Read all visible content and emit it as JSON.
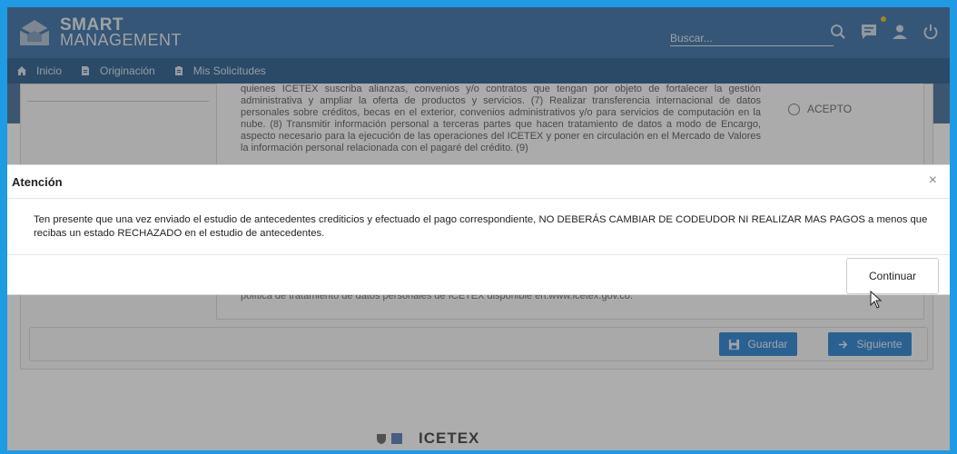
{
  "header": {
    "logo_line1": "SMART",
    "logo_line2": "MANAGEMENT",
    "search_placeholder": "Buscar..."
  },
  "nav": {
    "items": [
      {
        "label": "Inicio",
        "icon": "home-icon"
      },
      {
        "label": "Originación",
        "icon": "document-icon"
      },
      {
        "label": "Mis Solicitudes",
        "icon": "clipboard-icon"
      }
    ]
  },
  "page": {
    "legal_text": "quienes ICETEX suscriba alianzas, convenios y/o contratos que tengan por objeto de fortalecer la gestión administrativa y ampliar la oferta de productos y servicios. (7) Realizar transferencia internacional de datos personales sobre créditos, becas en el exterior, convenios administrativos y/o para servicios de computación en la nube. (8) Transmitir información personal a terceras partes que hacen tratamiento de datos a modo de Encargo, aspecto necesario para la ejecución de las operaciones del ICETEX y poner en circulación en el Mercado de Valores la información personal relacionada con el pagaré del crédito. (9)",
    "legal_footer": "política de tratamiento de datos personales de ICETEX disponible en:www.icetex.gov.co.",
    "accept_label": "ACEPTO",
    "save_label": "Guardar",
    "next_label": "Siguiente",
    "footer_logo": "ICETEX"
  },
  "modal": {
    "title": "Atención",
    "close_symbol": "×",
    "body": "Ten presente que una vez enviado el estudio de antecedentes crediticios y efectuado el pago correspondiente, NO DEBERÁS CAMBIAR DE CODEUDOR NI REALIZAR MAS PAGOS a menos que recibas un estado RECHAZADO en el estudio de antecedentes.",
    "continue_label": "Continuar"
  },
  "colors": {
    "header": "#4f7faf",
    "nav": "#3f6e9a",
    "accent": "#3f8fd6",
    "frame": "#1e9be3"
  }
}
